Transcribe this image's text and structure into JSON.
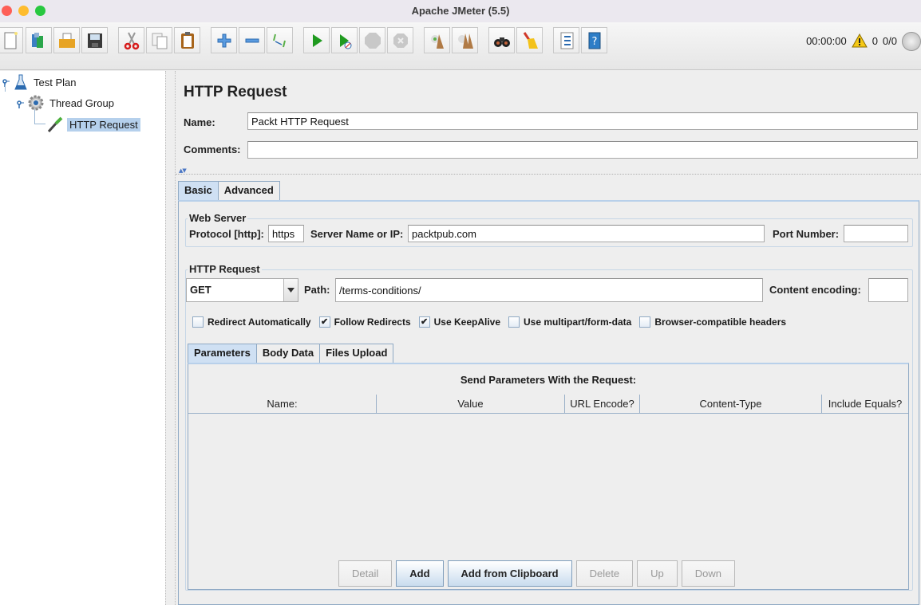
{
  "window": {
    "title": "Apache JMeter (5.5)"
  },
  "toolbar": {
    "buttons": [
      {
        "name": "new",
        "icon": "new-document-icon"
      },
      {
        "name": "templates",
        "icon": "templates-icon"
      },
      {
        "name": "open",
        "icon": "open-folder-icon"
      },
      {
        "name": "save",
        "icon": "save-disk-icon"
      },
      {
        "name": "cut",
        "icon": "scissors-icon"
      },
      {
        "name": "copy",
        "icon": "copy-icon"
      },
      {
        "name": "paste",
        "icon": "clipboard-icon"
      },
      {
        "name": "expand",
        "icon": "plus-icon"
      },
      {
        "name": "collapse",
        "icon": "minus-icon"
      },
      {
        "name": "toggle",
        "icon": "toggle-icon"
      },
      {
        "name": "start",
        "icon": "play-icon"
      },
      {
        "name": "start-no-pauses",
        "icon": "play-no-timers-icon"
      },
      {
        "name": "stop",
        "icon": "stop-icon"
      },
      {
        "name": "shutdown",
        "icon": "shutdown-icon"
      },
      {
        "name": "clear",
        "icon": "clear-broom-icon"
      },
      {
        "name": "clear-all",
        "icon": "clear-all-broom-icon"
      },
      {
        "name": "search",
        "icon": "binoculars-icon"
      },
      {
        "name": "reset-search",
        "icon": "broom-icon"
      },
      {
        "name": "function-helper",
        "icon": "list-icon"
      },
      {
        "name": "help",
        "icon": "help-book-icon"
      }
    ],
    "elapsed_time": "00:00:00",
    "warning_count": "0",
    "threads": "0/0"
  },
  "tree": {
    "nodes": [
      {
        "label": "Test Plan",
        "icon": "flask-icon"
      },
      {
        "label": "Thread Group",
        "icon": "gear-icon"
      },
      {
        "label": "HTTP Request",
        "icon": "pipette-icon",
        "selected": true
      }
    ]
  },
  "panel": {
    "title": "HTTP Request",
    "name_label": "Name:",
    "name_value": "Packt HTTP Request",
    "comments_label": "Comments:",
    "comments_value": "",
    "tabs": [
      {
        "label": "Basic",
        "active": true
      },
      {
        "label": "Advanced",
        "active": false
      }
    ],
    "web_server": {
      "title": "Web Server",
      "protocol_label": "Protocol [http]:",
      "protocol_value": "https",
      "server_label": "Server Name or IP:",
      "server_value": "packtpub.com",
      "port_label": "Port Number:",
      "port_value": ""
    },
    "http_request": {
      "title": "HTTP Request",
      "method": "GET",
      "path_label": "Path:",
      "path_value": "/terms-conditions/",
      "encoding_label": "Content encoding:",
      "encoding_value": ""
    },
    "checkboxes": [
      {
        "label": "Redirect Automatically",
        "checked": false
      },
      {
        "label": "Follow Redirects",
        "checked": true
      },
      {
        "label": "Use KeepAlive",
        "checked": true
      },
      {
        "label": "Use multipart/form-data",
        "checked": false
      },
      {
        "label": "Browser-compatible headers",
        "checked": false
      }
    ],
    "sub_tabs": [
      {
        "label": "Parameters",
        "active": true
      },
      {
        "label": "Body Data",
        "active": false
      },
      {
        "label": "Files Upload",
        "active": false
      }
    ],
    "params_table": {
      "title": "Send Parameters With the Request:",
      "columns": [
        "Name:",
        "Value",
        "URL Encode?",
        "Content-Type",
        "Include Equals?"
      ],
      "rows": []
    },
    "buttons": [
      {
        "label": "Detail",
        "enabled": false
      },
      {
        "label": "Add",
        "enabled": true
      },
      {
        "label": "Add from Clipboard",
        "enabled": true
      },
      {
        "label": "Delete",
        "enabled": false
      },
      {
        "label": "Up",
        "enabled": false
      },
      {
        "label": "Down",
        "enabled": false
      }
    ]
  }
}
